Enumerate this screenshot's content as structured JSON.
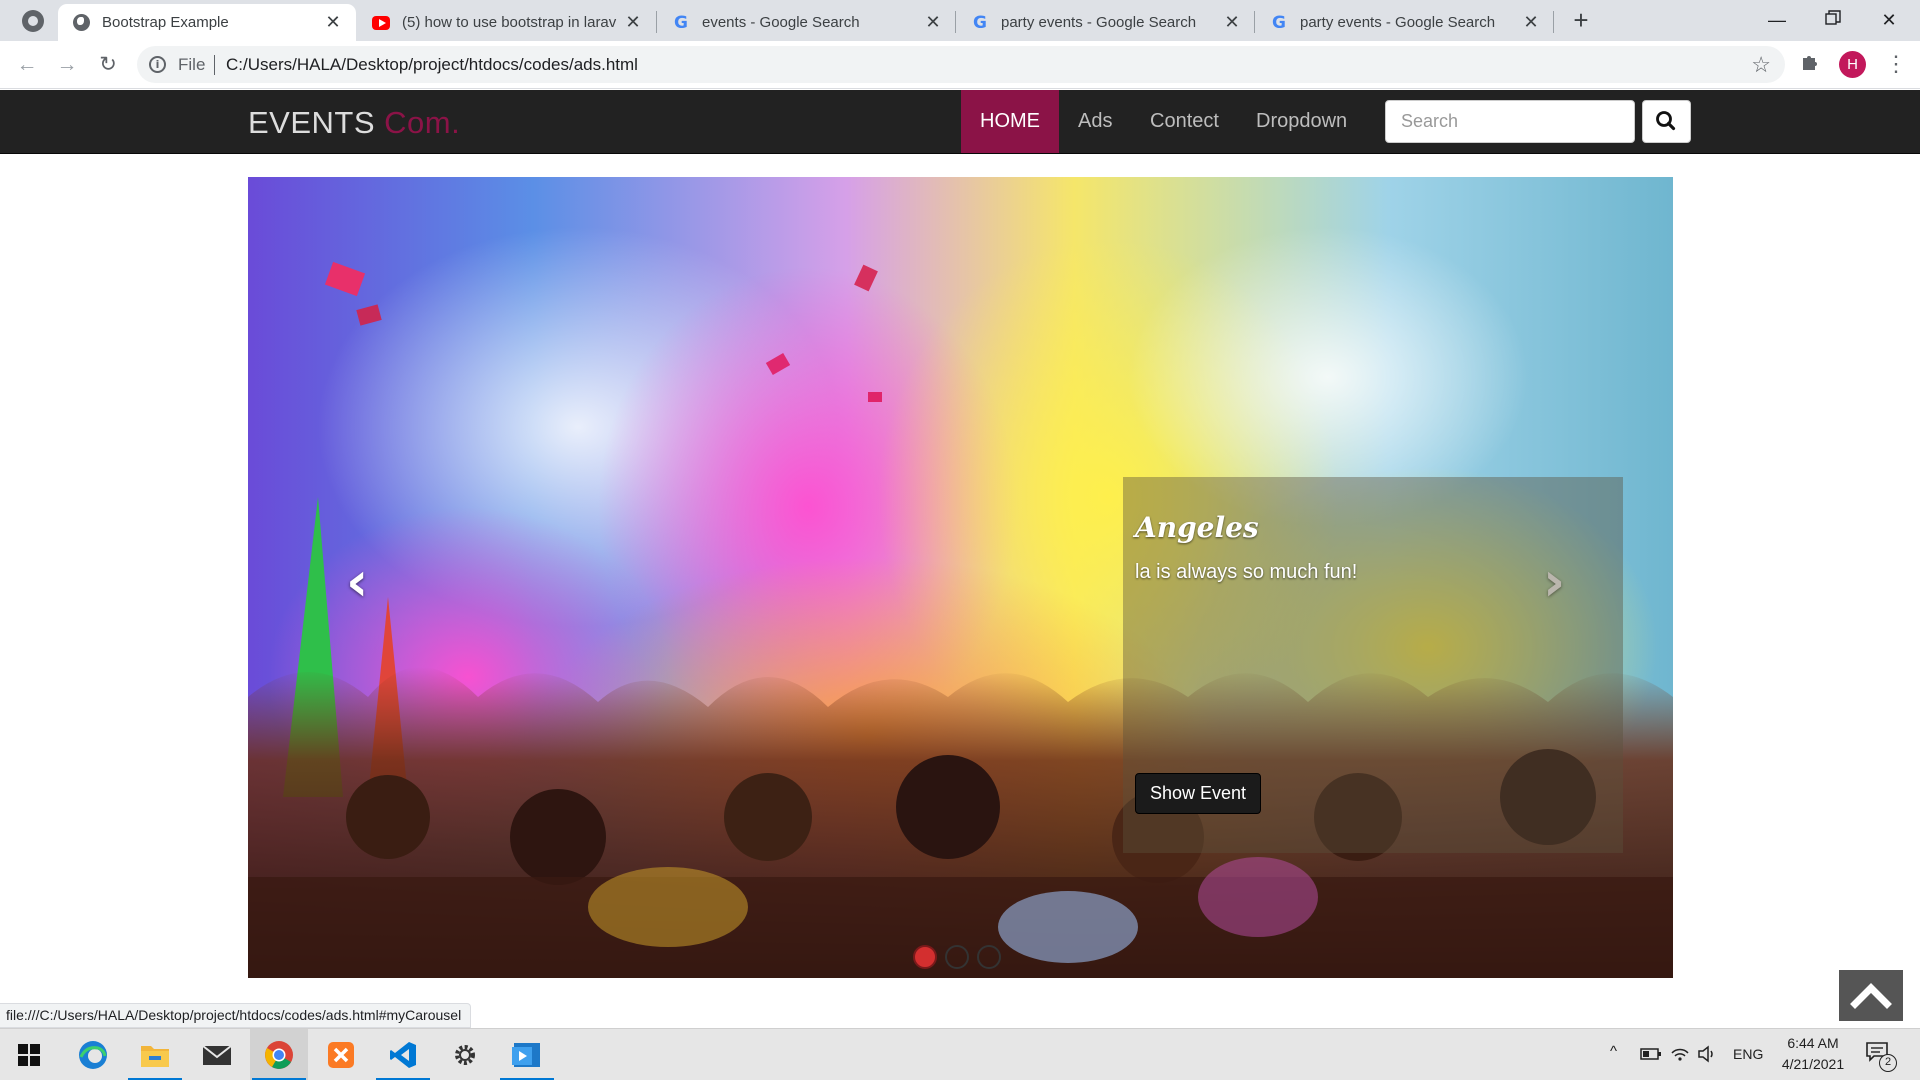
{
  "browser": {
    "tabs": [
      {
        "title": "Bootstrap Example",
        "favicon": "globe-icon",
        "active": true
      },
      {
        "title": "(5) how to use bootstrap in larav",
        "favicon": "youtube-icon",
        "active": false
      },
      {
        "title": "events - Google Search",
        "favicon": "google-icon",
        "active": false
      },
      {
        "title": "party events - Google Search",
        "favicon": "google-icon",
        "active": false
      },
      {
        "title": "party events - Google Search",
        "favicon": "google-icon",
        "active": false
      }
    ],
    "file_label": "File",
    "url": "C:/Users/HALA/Desktop/project/htdocs/codes/ads.html",
    "profile_initial": "H",
    "status_url": "file:///C:/Users/HALA/Desktop/project/htdocs/codes/ads.html#myCarousel"
  },
  "site": {
    "brand": "EVENTS",
    "brand_accent": "Com.",
    "nav": [
      "HOME",
      "Ads",
      "Contect",
      "Dropdown"
    ],
    "search_placeholder": "Search",
    "colors": {
      "accent": "#8b1347",
      "navbar": "#222222"
    }
  },
  "carousel": {
    "caption_title": "Angeles",
    "caption_text": "la is always so much fun!",
    "button_label": "Show Event",
    "slide_count": 3,
    "active_slide": 1
  },
  "taskbar": {
    "apps": [
      "windows-start-icon",
      "edge-icon",
      "file-explorer-icon",
      "mail-icon",
      "chrome-icon",
      "xampp-icon",
      "vscode-icon",
      "settings-icon",
      "media-player-icon"
    ],
    "language": "ENG",
    "time": "6:44 AM",
    "date": "4/21/2021",
    "notification_count": "2"
  }
}
